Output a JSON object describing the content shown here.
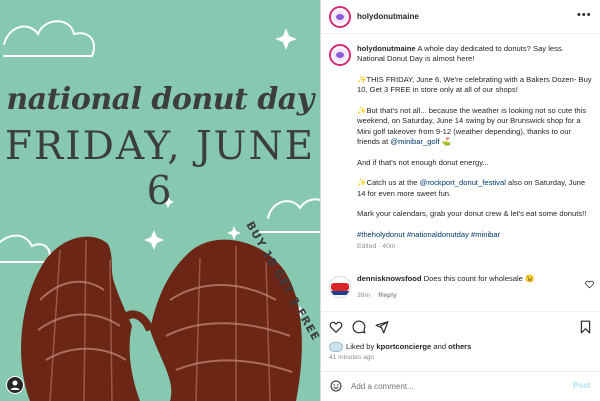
{
  "media": {
    "headline": "national donut day",
    "dateline": "FRIDAY, JUNE 6",
    "promo": "BUY 10 GET 3 FREE",
    "user_icon": "user-tag-icon"
  },
  "header": {
    "username": "holydonutmaine",
    "more_icon": "more-options-icon",
    "more_label": "•••"
  },
  "caption": {
    "username": "holydonutmaine",
    "intro": " A whole day dedicated to donuts? Say less. National Donut Day is almost here!",
    "p1": "✨THIS FRIDAY, June 6, We're celebrating with a Bakers Dozen- Buy 10, Get 3 FREE in store only at all of our shops!",
    "p2_text": "✨But that's not all... because the weather is looking not so cute this weekend, on Saturday, June 14 swing by our Brunswick shop for a Mini golf takeover from 9-12 (weather depending), thanks to our friends at ",
    "p2_mention": "@minibar_golf",
    "p2_end": " ⛳",
    "p3": "And if that's not enough donut energy...",
    "p4_start": "✨Catch us at the ",
    "p4_mention": "@rockport_donut_festival",
    "p4_end": " also on Saturday, June 14 for even more sweet fun.",
    "p5": "Mark your calendars, grab your donut crew & let's eat some donuts!!",
    "hashtags": "#theholydonut #nationaldonutday #minibar",
    "edited": "Edited · 40m"
  },
  "comment": {
    "username": "dennisknowsfood",
    "text": " Does this count for wholesale 😉",
    "time": "39m",
    "reply": "Reply"
  },
  "actions": {
    "like_icon": "heart-icon",
    "comment_icon": "comment-icon",
    "share_icon": "share-icon",
    "save_icon": "bookmark-icon"
  },
  "likes": {
    "prefix": "Liked by ",
    "user": "kportconcierge",
    "middle": " and ",
    "others": "others"
  },
  "time_ago": "41 minutes ago",
  "add_comment": {
    "emoji_icon": "emoji-icon",
    "placeholder": "Add a comment...",
    "post_label": "Post"
  },
  "colors": {
    "background": "#86c9b0",
    "link": "#00376b",
    "post_button": "#b2dffc",
    "muted": "#8e8e8e"
  }
}
